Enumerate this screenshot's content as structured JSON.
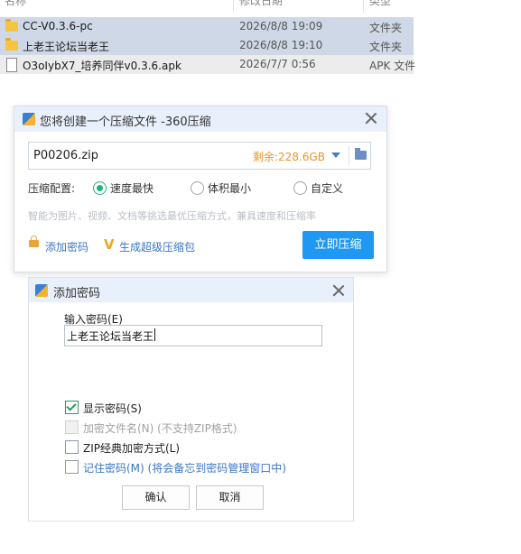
{
  "explorer": {
    "columns": [
      "名称",
      "修改日期",
      "类型"
    ],
    "files": [
      {
        "name": "CC-V0.3.6-pc",
        "date": "2026/8/8 19:09",
        "type": "文件夹",
        "icon": "folder-icon"
      },
      {
        "name": "上老王论坛当老王",
        "date": "2026/8/8 19:10",
        "type": "文件夹",
        "icon": "folder-icon"
      },
      {
        "name": "O3oIybX7_培养同伴v0.3.6.apk",
        "date": "2026/7/7 0:56",
        "type": "APK 文件",
        "icon": "file-icon"
      }
    ]
  },
  "compress_dialog": {
    "title": "您将创建一个压缩文件 -360压缩",
    "filename": "P00206.zip",
    "free_space": "剩余:228.6GB",
    "config_label": "压缩配置:",
    "options": [
      "速度最快",
      "体积最小",
      "自定义"
    ],
    "selected_option": "速度最快",
    "hint": "智能为图片、视频、文档等挑选最优压缩方式，兼具速度和压缩率",
    "add_password_link": "添加密码",
    "super_package_link": "生成超级压缩包",
    "compress_button": "立即压缩",
    "accent_color": "#1e98f0"
  },
  "password_dialog": {
    "title": "添加密码",
    "input_label": "输入密码(E)",
    "password_value": "上老王论坛当老王",
    "checkboxes": [
      {
        "label": "显示密码(S)",
        "checked": true,
        "disabled": false
      },
      {
        "label": "加密文件名(N) (不支持ZIP格式)",
        "checked": false,
        "disabled": true
      },
      {
        "label": "ZIP经典加密方式(L)",
        "checked": false,
        "disabled": false
      },
      {
        "label": "记住密码(M) (将会备忘到密码管理窗口中)",
        "checked": false,
        "disabled": false
      }
    ],
    "ok_button": "确认",
    "cancel_button": "取消"
  }
}
